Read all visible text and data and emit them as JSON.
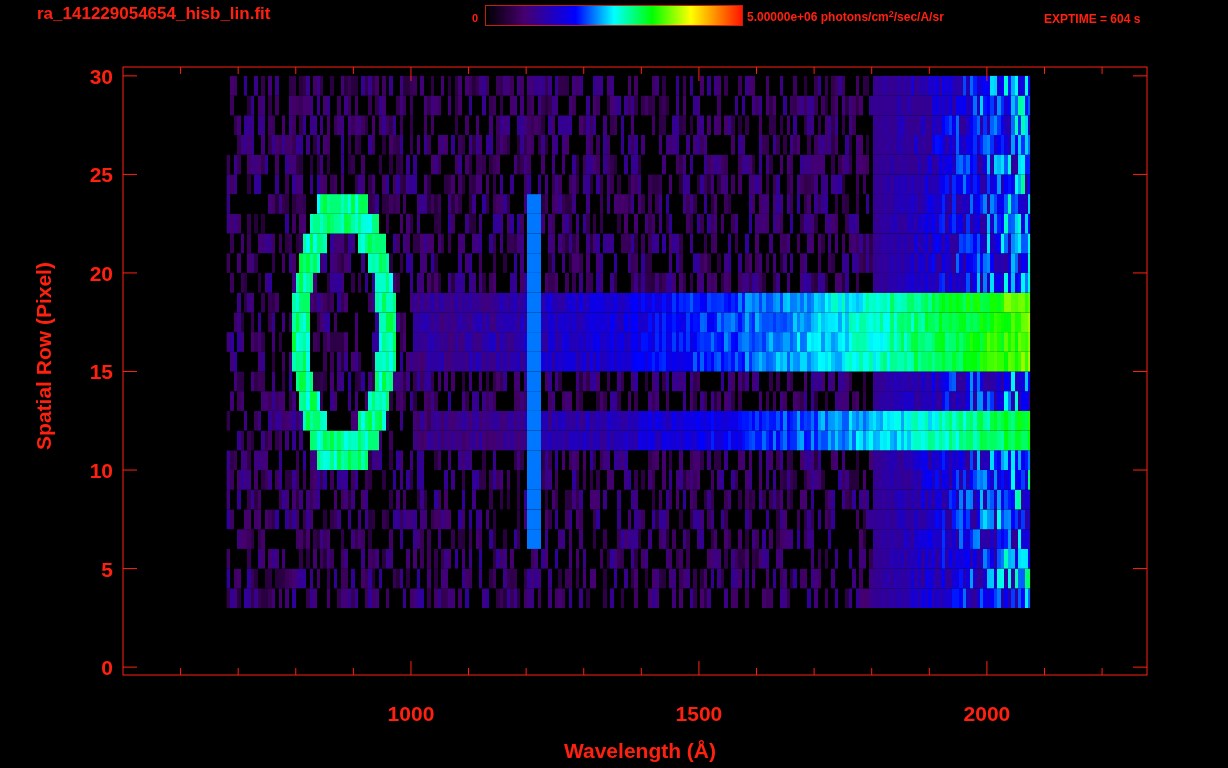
{
  "header": {
    "filename": "ra_141229054654_hisb_lin.fit",
    "colorbar_min": "0",
    "colorbar_max": "5.00000e+06 photons/cm$^{2}$/sec/A/sr",
    "exptime": "EXPTIME = 604 s"
  },
  "plot": {
    "chart_data": {
      "type": "scatter",
      "xlabel": "Wavelength (Å)",
      "ylabel": "Spatial Row (Pixel)",
      "xlim": [
        500,
        2278
      ],
      "ylim": [
        -0.4,
        30.45
      ],
      "xticks": [
        1000,
        1500,
        2000
      ],
      "yticks": [
        0,
        5,
        10,
        15,
        20,
        25,
        30
      ]
    }
  }
}
